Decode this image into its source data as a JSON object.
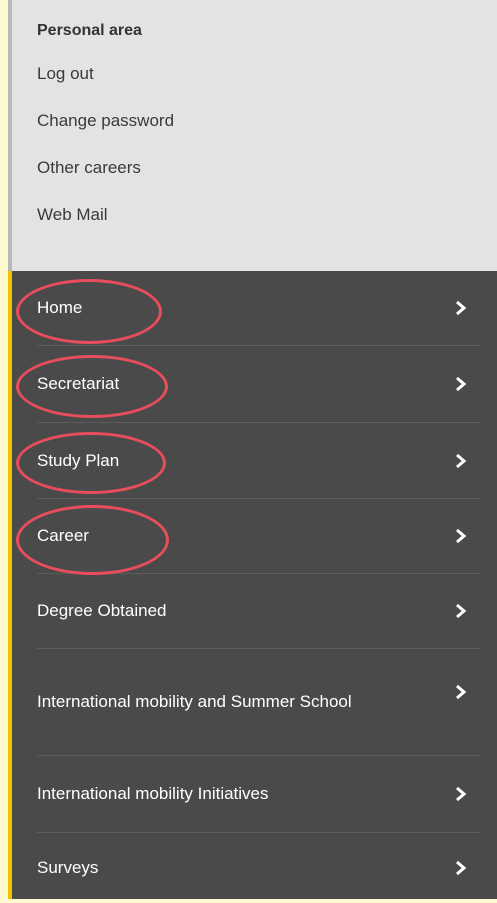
{
  "personal_area": {
    "title": "Personal area",
    "links": [
      "Log out",
      "Change password",
      "Other careers",
      "Web Mail"
    ]
  },
  "menu": {
    "items": [
      {
        "label": "Home",
        "icon": "chevron-right-icon",
        "circled": true
      },
      {
        "label": "Secretariat",
        "icon": "chevron-right-icon",
        "circled": true
      },
      {
        "label": "Study Plan",
        "icon": "chevron-right-icon",
        "circled": true
      },
      {
        "label": "Career",
        "icon": "chevron-right-icon",
        "circled": true
      },
      {
        "label": "Degree Obtained",
        "icon": "chevron-right-icon",
        "circled": false
      },
      {
        "label": "International mobility and Summer School",
        "icon": "chevron-right-icon",
        "circled": false
      },
      {
        "label": "International mobility Initiatives",
        "icon": "chevron-right-icon",
        "circled": false
      },
      {
        "label": "Surveys",
        "icon": "chevron-right-icon",
        "circled": false
      }
    ]
  },
  "colors": {
    "page_background": "#fef9cf",
    "personal_area_background": "#e3e3e3",
    "menu_background": "#4a4a4a",
    "accent_bar": "#f5c200",
    "highlight_ring": "#e84d5b",
    "menu_text": "#ffffff"
  }
}
